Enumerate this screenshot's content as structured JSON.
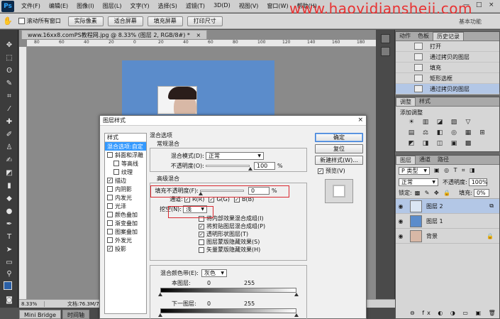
{
  "app": {
    "logo": "Ps",
    "menu": [
      "文件(F)",
      "编辑(E)",
      "图像(I)",
      "图层(L)",
      "文字(Y)",
      "选择(S)",
      "滤镜(T)",
      "3D(D)",
      "视图(V)",
      "窗口(W)",
      "帮助(H)"
    ],
    "watermark": "www.haoyidiansheji.com",
    "window_controls": [
      "—",
      "□",
      "×"
    ]
  },
  "options_bar": {
    "scroll_all_windows": {
      "label": "滚动所有窗口",
      "checked": false
    },
    "buttons": [
      "实际像素",
      "适合屏幕",
      "填充屏幕",
      "打印尺寸"
    ],
    "workspace": "基本功能"
  },
  "document": {
    "tab_title": "www.16xx8.comPS教程网.jpg @ 8.33% (图层 2, RGB/8#) *",
    "close": "×",
    "ruler_ticks": [
      "80",
      "60",
      "40",
      "20",
      "0",
      "20",
      "40",
      "60",
      "80",
      "100",
      "120",
      "140",
      "160",
      "180",
      "200"
    ],
    "zoom": "8.33%",
    "doc_info": "文档:76.3M/7",
    "bottom_tabs": [
      "Mini Bridge",
      "时间轴"
    ]
  },
  "history_panel": {
    "tabs": [
      "动作",
      "色板",
      "历史记录"
    ],
    "active_tab": "历史记录",
    "rows": [
      {
        "label": "打开",
        "selected": false
      },
      {
        "label": "通过拷贝的图层",
        "selected": false
      },
      {
        "label": "填充",
        "selected": false
      },
      {
        "label": "矩形选框",
        "selected": false
      },
      {
        "label": "通过拷贝的图层",
        "selected": true
      }
    ]
  },
  "adjustments_panel": {
    "tabs": [
      "调整",
      "样式"
    ],
    "active_tab": "调整",
    "title": "添加调整",
    "icons": [
      "☀",
      "▥",
      "◪",
      "▨",
      "▽",
      "",
      "▤",
      "⚖",
      "◧",
      "◎",
      "▦",
      "⊞",
      "◩",
      "◨",
      "◫",
      "▣",
      "▩",
      ""
    ]
  },
  "layers_panel": {
    "tabs": [
      "图层",
      "通道",
      "路径"
    ],
    "active_tab": "图层",
    "filter_label": "P 类型",
    "blend_mode": "正常",
    "opacity_label": "不透明度:",
    "opacity_value": "100%",
    "lock_label": "锁定:",
    "fill_label": "填充:",
    "fill_value": "0%",
    "layers": [
      {
        "name": "图层 2",
        "selected": true,
        "thumb": "#dbe6f4",
        "fx": "⧉"
      },
      {
        "name": "图层 1",
        "selected": false,
        "thumb": "#5b8ccb",
        "fx": ""
      },
      {
        "name": "背景",
        "selected": false,
        "thumb": "#d8b8a6",
        "fx": "🔒"
      }
    ],
    "bottom_icons": "⊖ fx ◐ ◑ ▭ ▣ 🗑"
  },
  "dialog": {
    "title": "图层样式",
    "close": "×",
    "styles_list": [
      {
        "label": "样式",
        "type": "head"
      },
      {
        "label": "混合选项:自定",
        "type": "item",
        "selected": true
      },
      {
        "label": "斜面和浮雕",
        "type": "check",
        "checked": false
      },
      {
        "label": "等高线",
        "type": "check-indent",
        "checked": false
      },
      {
        "label": "纹理",
        "type": "check-indent",
        "checked": false
      },
      {
        "label": "描边",
        "type": "check",
        "checked": true
      },
      {
        "label": "内阴影",
        "type": "check",
        "checked": false
      },
      {
        "label": "内发光",
        "type": "check",
        "checked": false
      },
      {
        "label": "光泽",
        "type": "check",
        "checked": false
      },
      {
        "label": "颜色叠加",
        "type": "check",
        "checked": false
      },
      {
        "label": "渐变叠加",
        "type": "check",
        "checked": false
      },
      {
        "label": "图案叠加",
        "type": "check",
        "checked": false
      },
      {
        "label": "外发光",
        "type": "check",
        "checked": false
      },
      {
        "label": "投影",
        "type": "check",
        "checked": true
      }
    ],
    "blend_options": {
      "group_label": "混合选项",
      "general_label": "常规混合",
      "blend_mode_label": "混合模式(D):",
      "blend_mode_value": "正常",
      "opacity_label": "不透明度(O):",
      "opacity_value": "100",
      "opacity_unit": "%",
      "opacity_level": 1.0,
      "advanced_label": "高级混合",
      "fill_opacity_label": "填充不透明度(F):",
      "fill_opacity_value": "0",
      "fill_opacity_unit": "%",
      "fill_opacity_level": 0.0,
      "channels_label": "通道:",
      "channels": [
        {
          "label": "R(R)",
          "checked": true
        },
        {
          "label": "G(G)",
          "checked": true
        },
        {
          "label": "B(B)",
          "checked": true
        }
      ],
      "knockout_label": "挖空(N):",
      "knockout_value": "浅",
      "options": [
        {
          "label": "将内部效果混合成组(I)",
          "checked": false
        },
        {
          "label": "将剪贴图层混合成组(P)",
          "checked": true
        },
        {
          "label": "透明形状图层(T)",
          "checked": true
        },
        {
          "label": "图层蒙版隐藏效果(S)",
          "checked": false
        },
        {
          "label": "矢量蒙版隐藏效果(H)",
          "checked": false
        }
      ],
      "blend_if_label": "混合颜色带(E):",
      "blend_if_value": "灰色",
      "this_layer_label": "本图层:",
      "this_layer_min": "0",
      "this_layer_max": "255",
      "underlying_label": "下一图层:",
      "underlying_min": "0",
      "underlying_max": "255"
    },
    "buttons": {
      "ok": "确定",
      "reset": "复位",
      "new_style": "新建样式(W)...",
      "preview_label": "预览(V)",
      "preview_checked": true
    }
  }
}
